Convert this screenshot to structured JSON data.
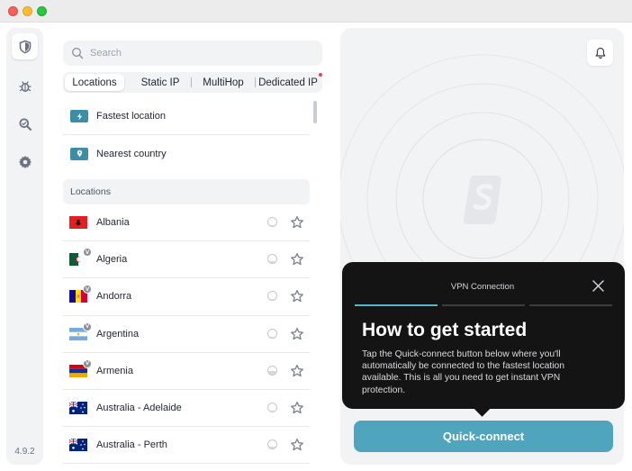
{
  "app": {
    "version": "4.9.2",
    "accent_color": "#4fa5be"
  },
  "sidebar_rail": [
    {
      "name": "vpn",
      "icon": "shield-icon"
    },
    {
      "name": "antivirus",
      "icon": "bug-icon"
    },
    {
      "name": "search",
      "icon": "search-icon"
    },
    {
      "name": "settings",
      "icon": "gear-icon"
    }
  ],
  "search": {
    "placeholder": "Search",
    "value": ""
  },
  "tabs": [
    {
      "label": "Locations",
      "active": true
    },
    {
      "label": "Static IP",
      "active": false
    },
    {
      "label": "MultiHop",
      "active": false
    },
    {
      "label": "Dedicated IP",
      "active": false,
      "notification_dot": true
    }
  ],
  "quick_options": [
    {
      "label": "Fastest location",
      "icon": "lightning-icon"
    },
    {
      "label": "Nearest country",
      "icon": "location-pin-icon"
    }
  ],
  "locations_header": "Locations",
  "countries": [
    {
      "name": "Albania",
      "virtual": false,
      "load": 0.15
    },
    {
      "name": "Algeria",
      "virtual": true,
      "load": 0.2
    },
    {
      "name": "Andorra",
      "virtual": true,
      "load": 0.2
    },
    {
      "name": "Argentina",
      "virtual": true,
      "load": 0.1
    },
    {
      "name": "Armenia",
      "virtual": true,
      "load": 0.45
    },
    {
      "name": "Australia - Adelaide",
      "virtual": false,
      "load": 0.15
    },
    {
      "name": "Australia - Perth",
      "virtual": false,
      "load": 0.25
    }
  ],
  "virtual_badge": "V",
  "onboarding": {
    "step_label": "VPN Connection",
    "title": "How to get started",
    "body": "Tap the Quick-connect button below where you'll automatically be connected to the fastest location available. This is all you need to get instant VPN protection."
  },
  "quick_connect_label": "Quick-connect"
}
